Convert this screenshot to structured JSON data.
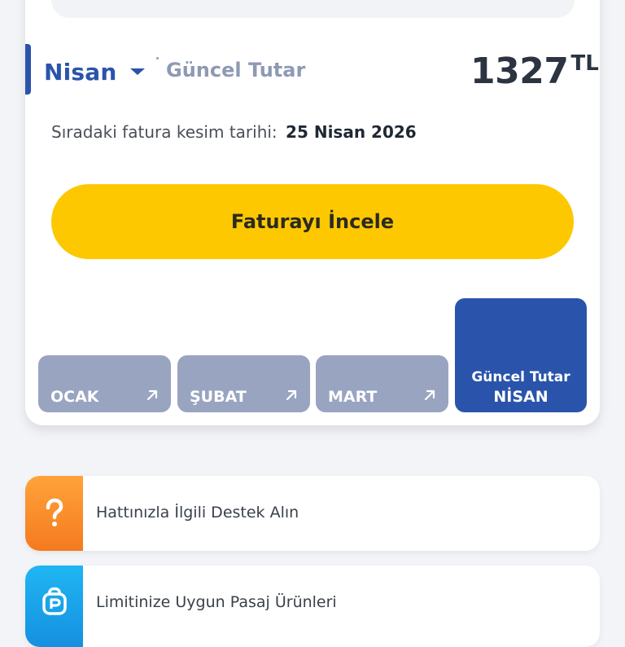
{
  "invoice_card": {
    "month_selector": {
      "label": "Nisan"
    },
    "current_amount_label": "Güncel Tutar",
    "amount": "1327",
    "currency": "TL",
    "next_invoice": {
      "prefix": "Sıradaki fatura kesim tarihi:",
      "date": "25 Nisan 2026"
    },
    "cta_label": "Faturayı İncele",
    "months": [
      {
        "label": "OCAK"
      },
      {
        "label": "ŞUBAT"
      },
      {
        "label": "MART"
      }
    ],
    "active_month": {
      "sub_label": "Güncel Tutar",
      "label": "NİSAN"
    }
  },
  "list": [
    {
      "label": "Hattınızla İlgili Destek Alın",
      "icon": "question-mark-icon"
    },
    {
      "label": "Limitinize Uygun Pasaj Ürünleri",
      "icon": "pasaj-icon"
    }
  ],
  "colors": {
    "brand_blue": "#2a54ab",
    "tile_grey": "#99a4c1",
    "cta_yellow": "#fdc800",
    "orange": "#f7892a",
    "cyan": "#1d9fe8"
  }
}
